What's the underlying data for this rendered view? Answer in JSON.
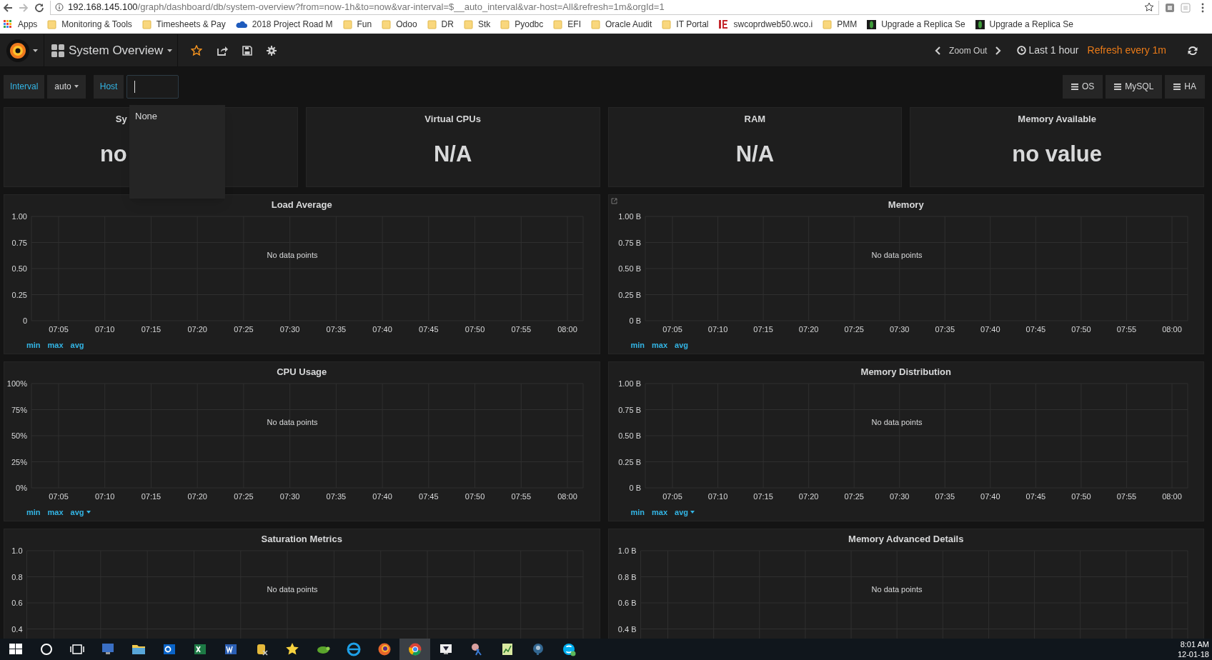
{
  "browser": {
    "url": {
      "host": "192.168.145.100",
      "path": "/graph/dashboard/db/system-overview?from=now-1h&to=now&var-interval=$__auto_interval&var-host=All&refresh=1m&orgId=1"
    },
    "apps_label": "Apps",
    "bookmarks": [
      {
        "kind": "folder",
        "label": "Monitoring & Tools"
      },
      {
        "kind": "folder",
        "label": "Timesheets & Pay"
      },
      {
        "kind": "cloud",
        "label": "2018 Project Road M"
      },
      {
        "kind": "folder",
        "label": "Fun"
      },
      {
        "kind": "folder",
        "label": "Odoo"
      },
      {
        "kind": "folder",
        "label": "DR"
      },
      {
        "kind": "folder",
        "label": "Stk"
      },
      {
        "kind": "folder",
        "label": "Pyodbc"
      },
      {
        "kind": "folder",
        "label": "EFI"
      },
      {
        "kind": "folder",
        "label": "Oracle Audit"
      },
      {
        "kind": "folder",
        "label": "IT Portal"
      },
      {
        "kind": "site",
        "label": "swcoprdweb50.wco.i"
      },
      {
        "kind": "folder",
        "label": "PMM"
      },
      {
        "kind": "leaf",
        "label": "Upgrade a Replica Se"
      },
      {
        "kind": "leaf",
        "label": "Upgrade a Replica Se"
      }
    ]
  },
  "navbar": {
    "dashboard_title": "System Overview",
    "zoom_out": "Zoom Out",
    "time_range": "Last 1 hour",
    "refresh": "Refresh every 1m"
  },
  "variables": [
    {
      "kind": "dropdown",
      "label": "Interval",
      "value": "auto"
    },
    {
      "kind": "input",
      "label": "Host"
    }
  ],
  "host_dropdown": {
    "options": [
      "None"
    ]
  },
  "dashboard_links": [
    "OS",
    "MySQL",
    "HA"
  ],
  "stats": [
    {
      "title": "Sy",
      "value": "no"
    },
    {
      "title": "Virtual CPUs",
      "value": "N/A"
    },
    {
      "title": "RAM",
      "value": "N/A"
    },
    {
      "title": "Memory Available",
      "value": "no value"
    }
  ],
  "graphs": [
    {
      "link": false,
      "message": "No data points",
      "legend": [
        {
          "label": "min",
          "sorted": false
        },
        {
          "label": "max",
          "sorted": false
        },
        {
          "label": "avg",
          "sorted": false
        }
      ],
      "chart_data": {
        "type": "line",
        "title": "Load Average",
        "grid": true,
        "categories": [
          "07:05",
          "07:10",
          "07:15",
          "07:20",
          "07:25",
          "07:30",
          "07:35",
          "07:40",
          "07:45",
          "07:50",
          "07:55",
          "08:00"
        ],
        "ylim": [
          0,
          1
        ],
        "yticks": [
          {
            "value": 1,
            "label": "1.00"
          },
          {
            "value": 0.75,
            "label": "0.75"
          },
          {
            "value": 0.5,
            "label": "0.50"
          },
          {
            "value": 0.25,
            "label": "0.25"
          },
          {
            "value": 0,
            "label": "0"
          }
        ]
      }
    },
    {
      "link": true,
      "message": "No data points",
      "legend": [
        {
          "label": "min",
          "sorted": false
        },
        {
          "label": "max",
          "sorted": false
        },
        {
          "label": "avg",
          "sorted": false
        }
      ],
      "chart_data": {
        "type": "line",
        "title": "Memory",
        "grid": true,
        "categories": [
          "07:05",
          "07:10",
          "07:15",
          "07:20",
          "07:25",
          "07:30",
          "07:35",
          "07:40",
          "07:45",
          "07:50",
          "07:55",
          "08:00"
        ],
        "ylim": [
          0,
          1
        ],
        "yticks": [
          {
            "value": 1,
            "label": "1.00 B"
          },
          {
            "value": 0.75,
            "label": "0.75 B"
          },
          {
            "value": 0.5,
            "label": "0.50 B"
          },
          {
            "value": 0.25,
            "label": "0.25 B"
          },
          {
            "value": 0,
            "label": "0 B"
          }
        ]
      }
    },
    {
      "link": false,
      "message": "No data points",
      "legend": [
        {
          "label": "min",
          "sorted": false
        },
        {
          "label": "max",
          "sorted": false
        },
        {
          "label": "avg",
          "sorted": true
        }
      ],
      "chart_data": {
        "type": "line",
        "title": "CPU Usage",
        "grid": true,
        "categories": [
          "07:05",
          "07:10",
          "07:15",
          "07:20",
          "07:25",
          "07:30",
          "07:35",
          "07:40",
          "07:45",
          "07:50",
          "07:55",
          "08:00"
        ],
        "ylim": [
          0,
          100
        ],
        "yticks": [
          {
            "value": 100,
            "label": "100%"
          },
          {
            "value": 75,
            "label": "75%"
          },
          {
            "value": 50,
            "label": "50%"
          },
          {
            "value": 25,
            "label": "25%"
          },
          {
            "value": 0,
            "label": "0%"
          }
        ]
      }
    },
    {
      "link": false,
      "message": "No data points",
      "legend": [
        {
          "label": "min",
          "sorted": false
        },
        {
          "label": "max",
          "sorted": false
        },
        {
          "label": "avg",
          "sorted": true
        }
      ],
      "chart_data": {
        "type": "line",
        "title": "Memory Distribution",
        "grid": true,
        "categories": [
          "07:05",
          "07:10",
          "07:15",
          "07:20",
          "07:25",
          "07:30",
          "07:35",
          "07:40",
          "07:45",
          "07:50",
          "07:55",
          "08:00"
        ],
        "ylim": [
          0,
          1
        ],
        "yticks": [
          {
            "value": 1,
            "label": "1.00 B"
          },
          {
            "value": 0.75,
            "label": "0.75 B"
          },
          {
            "value": 0.5,
            "label": "0.50 B"
          },
          {
            "value": 0.25,
            "label": "0.25 B"
          },
          {
            "value": 0,
            "label": "0 B"
          }
        ]
      }
    },
    {
      "link": false,
      "message": "No data points",
      "chart_data": {
        "type": "line",
        "title": "Saturation Metrics",
        "grid": true,
        "categories": [
          null,
          null,
          null,
          null,
          null,
          null,
          null,
          null,
          null,
          null,
          null,
          null
        ],
        "ylim": [
          0,
          1
        ],
        "yticks": [
          {
            "value": 1,
            "label": "1.0"
          },
          {
            "value": 0.8,
            "label": "0.8"
          },
          {
            "value": 0.6,
            "label": "0.6"
          },
          {
            "value": 0.4,
            "label": "0.4"
          }
        ]
      }
    },
    {
      "link": false,
      "message": "No data points",
      "chart_data": {
        "type": "line",
        "title": "Memory Advanced Details",
        "grid": true,
        "categories": [
          null,
          null,
          null,
          null,
          null,
          null,
          null,
          null,
          null,
          null,
          null,
          null
        ],
        "ylim": [
          0,
          1
        ],
        "yticks": [
          {
            "value": 1,
            "label": "1.0 B"
          },
          {
            "value": 0.8,
            "label": "0.8 B"
          },
          {
            "value": 0.6,
            "label": "0.6 B"
          },
          {
            "value": 0.4,
            "label": "0.4 B"
          }
        ]
      }
    }
  ],
  "taskbar": {
    "time": "8:01 AM",
    "date": "12-01-18"
  }
}
